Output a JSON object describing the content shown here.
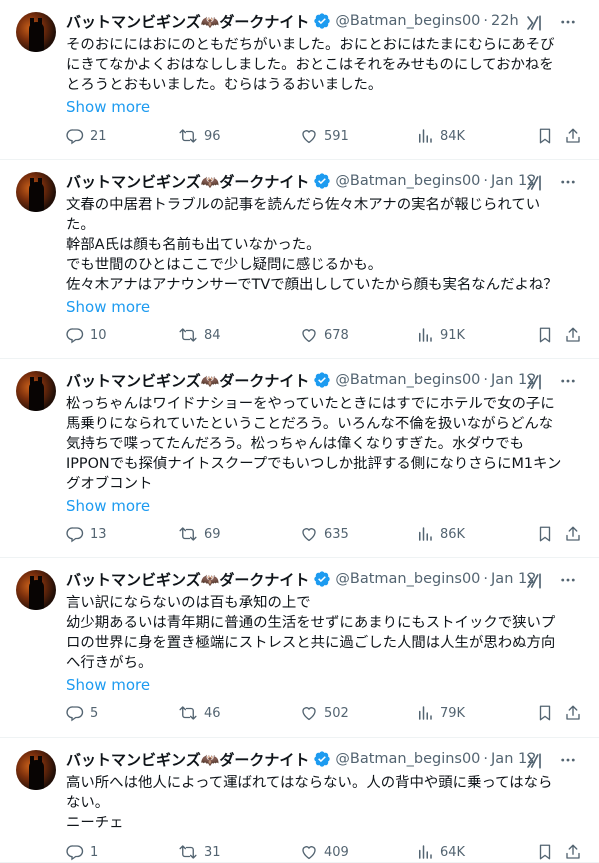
{
  "author": {
    "name": "バットマンビギンズ🦇ダークナイト",
    "handle": "@Batman_begins00"
  },
  "show_more_label": "Show more",
  "tweets": [
    {
      "time": "22h",
      "lines": [
        "そのおににはおにのともだちがいました。おにとおにはたまにむらにあそび",
        "にきてなかよくおはなししました。おとこはそれをみせものにしておかねを",
        "とろうとおもいました。むらはうるおいました。"
      ],
      "show_more": true,
      "replies": "21",
      "reposts": "96",
      "likes": "591",
      "views": "84K"
    },
    {
      "time": "Jan 12",
      "lines": [
        "文春の中居君トラブルの記事を読んだら佐々木アナの実名が報じられてい",
        "た。",
        "幹部A氏は顔も名前も出ていなかった。",
        "でも世間のひとはここで少し疑問に感じるかも。",
        "佐々木アナはアナウンサーでTVで顔出ししていたから顔も実名なんだよね？"
      ],
      "show_more": true,
      "replies": "10",
      "reposts": "84",
      "likes": "678",
      "views": "91K"
    },
    {
      "time": "Jan 12",
      "lines": [
        "松っちゃんはワイドナショーをやっていたときにはすでにホテルで女の子に",
        "馬乗りになられていたということだろう。いろんな不倫を扱いながらどんな",
        "気持ちで喋ってたんだろう。松っちゃんは偉くなりすぎた。水ダウでも",
        "IPPONでも探偵ナイトスクープでもいつしか批評する側になりさらにM1キン",
        "グオブコント"
      ],
      "show_more": true,
      "replies": "13",
      "reposts": "69",
      "likes": "635",
      "views": "86K"
    },
    {
      "time": "Jan 12",
      "lines": [
        "言い訳にならないのは百も承知の上で",
        "幼少期あるいは青年期に普通の生活をせずにあまりにもストイックで狭いプ",
        "ロの世界に身を置き極端にストレスと共に過ごした人間は人生が思わぬ方向",
        "へ行きがち。"
      ],
      "show_more": true,
      "replies": "5",
      "reposts": "46",
      "likes": "502",
      "views": "79K"
    },
    {
      "time": "Jan 12",
      "lines": [
        "高い所へは他人によって運ばれてはならない。人の背中や頭に乗ってはなら",
        "ない。",
        "ニーチェ"
      ],
      "show_more": false,
      "replies": "1",
      "reposts": "31",
      "likes": "409",
      "views": "64K"
    }
  ]
}
